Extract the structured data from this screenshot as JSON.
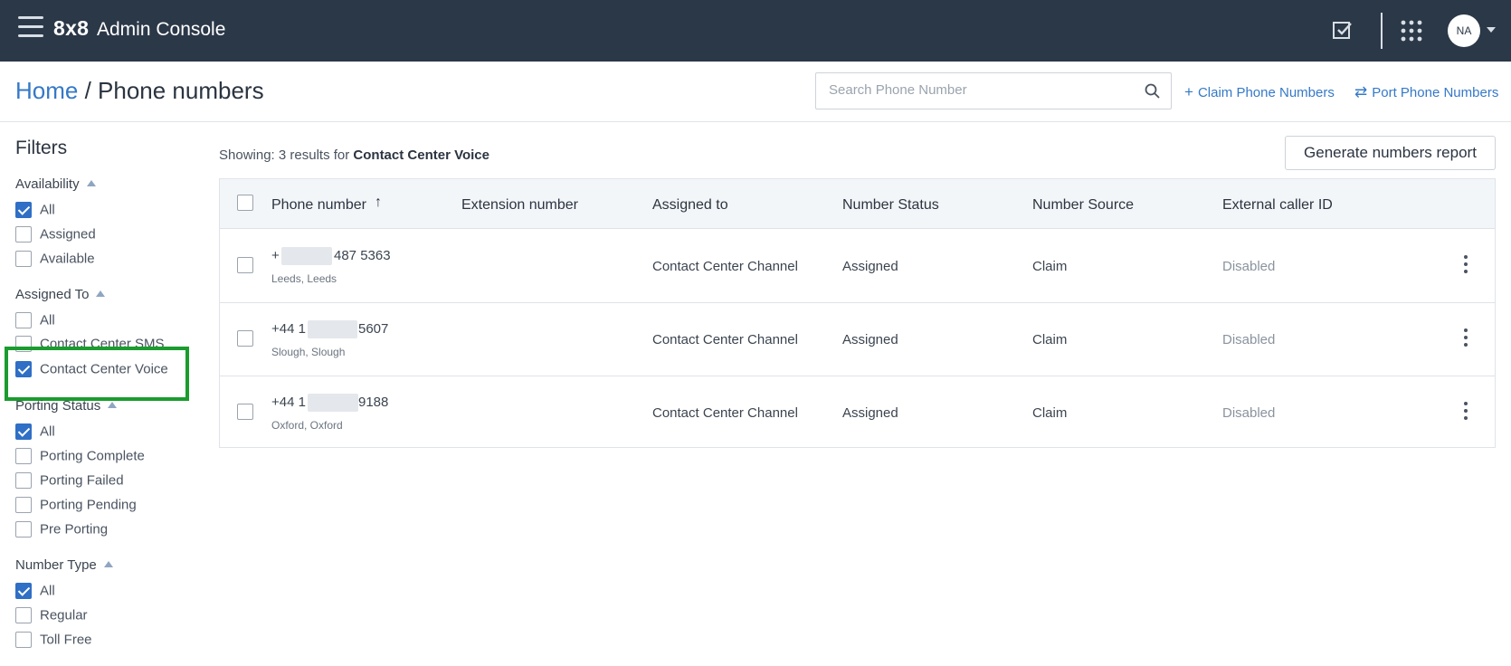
{
  "topbar": {
    "logo": "8x8",
    "title": "Admin Console",
    "avatar": "NA"
  },
  "header": {
    "breadcrumb_home": "Home",
    "breadcrumb_sep": " / ",
    "breadcrumb_current": "Phone numbers",
    "search_placeholder": "Search Phone Number",
    "claim_label": "Claim Phone Numbers",
    "port_label": "Port Phone Numbers"
  },
  "filters": {
    "title": "Filters",
    "groups": [
      {
        "title": "Availability",
        "options": [
          {
            "label": "All",
            "checked": true
          },
          {
            "label": "Assigned",
            "checked": false
          },
          {
            "label": "Available",
            "checked": false
          }
        ]
      },
      {
        "title": "Assigned To",
        "options": [
          {
            "label": "All",
            "checked": false
          },
          {
            "label": "Contact Center SMS",
            "checked": false
          },
          {
            "label": "Contact Center Voice",
            "checked": true
          }
        ]
      },
      {
        "title": "Porting Status",
        "options": [
          {
            "label": "All",
            "checked": true
          },
          {
            "label": "Porting Complete",
            "checked": false
          },
          {
            "label": "Porting Failed",
            "checked": false
          },
          {
            "label": "Porting Pending",
            "checked": false
          },
          {
            "label": "Pre Porting",
            "checked": false
          }
        ]
      },
      {
        "title": "Number Type",
        "options": [
          {
            "label": "All",
            "checked": true
          },
          {
            "label": "Regular",
            "checked": false
          },
          {
            "label": "Toll Free",
            "checked": false
          }
        ]
      }
    ]
  },
  "results": {
    "showing_prefix": "Showing: 3 results for ",
    "showing_term": "Contact Center Voice",
    "report_button": "Generate numbers report"
  },
  "table": {
    "columns": [
      "Phone number",
      "Extension number",
      "Assigned to",
      "Number Status",
      "Number Source",
      "External caller ID"
    ],
    "rows": [
      {
        "number_start": "+",
        "number_end": "487 5363",
        "location": "Leeds, Leeds",
        "extension": "",
        "assigned_to": "Contact Center Channel",
        "status": "Assigned",
        "source": "Claim",
        "caller_id": "Disabled"
      },
      {
        "number_start": "+44 1",
        "number_end": "5607",
        "location": "Slough, Slough",
        "extension": "",
        "assigned_to": "Contact Center Channel",
        "status": "Assigned",
        "source": "Claim",
        "caller_id": "Disabled"
      },
      {
        "number_start": "+44 1",
        "number_end": "9188",
        "location": "Oxford, Oxford",
        "extension": "",
        "assigned_to": "Contact Center Channel",
        "status": "Assigned",
        "source": "Claim",
        "caller_id": "Disabled"
      }
    ]
  },
  "colors": {
    "topbar": "#2b3848",
    "link": "#3579c7",
    "checkbox_on": "#2f6fc5",
    "highlight": "#1a9c2e"
  },
  "icons": {
    "menu": "hamburger-icon",
    "tasks": "checkbox-icon",
    "apps": "grid-icon",
    "search": "search-icon",
    "claim": "plus-icon",
    "port": "swap-arrows-icon",
    "sort": "sort-up-arrow-icon",
    "row_menu": "kebab-icon"
  }
}
